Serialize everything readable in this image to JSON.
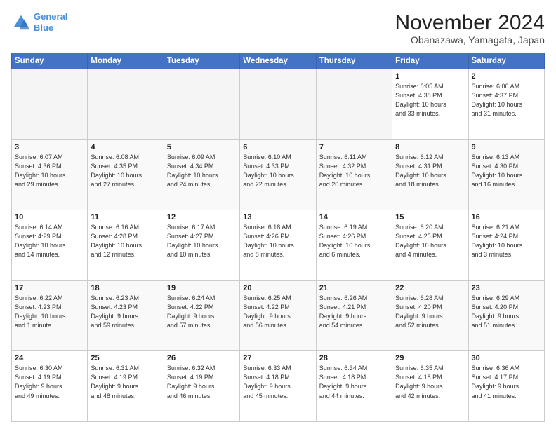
{
  "logo": {
    "line1": "General",
    "line2": "Blue"
  },
  "header": {
    "month": "November 2024",
    "location": "Obanazawa, Yamagata, Japan"
  },
  "weekdays": [
    "Sunday",
    "Monday",
    "Tuesday",
    "Wednesday",
    "Thursday",
    "Friday",
    "Saturday"
  ],
  "weeks": [
    [
      {
        "day": "",
        "info": ""
      },
      {
        "day": "",
        "info": ""
      },
      {
        "day": "",
        "info": ""
      },
      {
        "day": "",
        "info": ""
      },
      {
        "day": "",
        "info": ""
      },
      {
        "day": "1",
        "info": "Sunrise: 6:05 AM\nSunset: 4:38 PM\nDaylight: 10 hours\nand 33 minutes."
      },
      {
        "day": "2",
        "info": "Sunrise: 6:06 AM\nSunset: 4:37 PM\nDaylight: 10 hours\nand 31 minutes."
      }
    ],
    [
      {
        "day": "3",
        "info": "Sunrise: 6:07 AM\nSunset: 4:36 PM\nDaylight: 10 hours\nand 29 minutes."
      },
      {
        "day": "4",
        "info": "Sunrise: 6:08 AM\nSunset: 4:35 PM\nDaylight: 10 hours\nand 27 minutes."
      },
      {
        "day": "5",
        "info": "Sunrise: 6:09 AM\nSunset: 4:34 PM\nDaylight: 10 hours\nand 24 minutes."
      },
      {
        "day": "6",
        "info": "Sunrise: 6:10 AM\nSunset: 4:33 PM\nDaylight: 10 hours\nand 22 minutes."
      },
      {
        "day": "7",
        "info": "Sunrise: 6:11 AM\nSunset: 4:32 PM\nDaylight: 10 hours\nand 20 minutes."
      },
      {
        "day": "8",
        "info": "Sunrise: 6:12 AM\nSunset: 4:31 PM\nDaylight: 10 hours\nand 18 minutes."
      },
      {
        "day": "9",
        "info": "Sunrise: 6:13 AM\nSunset: 4:30 PM\nDaylight: 10 hours\nand 16 minutes."
      }
    ],
    [
      {
        "day": "10",
        "info": "Sunrise: 6:14 AM\nSunset: 4:29 PM\nDaylight: 10 hours\nand 14 minutes."
      },
      {
        "day": "11",
        "info": "Sunrise: 6:16 AM\nSunset: 4:28 PM\nDaylight: 10 hours\nand 12 minutes."
      },
      {
        "day": "12",
        "info": "Sunrise: 6:17 AM\nSunset: 4:27 PM\nDaylight: 10 hours\nand 10 minutes."
      },
      {
        "day": "13",
        "info": "Sunrise: 6:18 AM\nSunset: 4:26 PM\nDaylight: 10 hours\nand 8 minutes."
      },
      {
        "day": "14",
        "info": "Sunrise: 6:19 AM\nSunset: 4:26 PM\nDaylight: 10 hours\nand 6 minutes."
      },
      {
        "day": "15",
        "info": "Sunrise: 6:20 AM\nSunset: 4:25 PM\nDaylight: 10 hours\nand 4 minutes."
      },
      {
        "day": "16",
        "info": "Sunrise: 6:21 AM\nSunset: 4:24 PM\nDaylight: 10 hours\nand 3 minutes."
      }
    ],
    [
      {
        "day": "17",
        "info": "Sunrise: 6:22 AM\nSunset: 4:23 PM\nDaylight: 10 hours\nand 1 minute."
      },
      {
        "day": "18",
        "info": "Sunrise: 6:23 AM\nSunset: 4:23 PM\nDaylight: 9 hours\nand 59 minutes."
      },
      {
        "day": "19",
        "info": "Sunrise: 6:24 AM\nSunset: 4:22 PM\nDaylight: 9 hours\nand 57 minutes."
      },
      {
        "day": "20",
        "info": "Sunrise: 6:25 AM\nSunset: 4:22 PM\nDaylight: 9 hours\nand 56 minutes."
      },
      {
        "day": "21",
        "info": "Sunrise: 6:26 AM\nSunset: 4:21 PM\nDaylight: 9 hours\nand 54 minutes."
      },
      {
        "day": "22",
        "info": "Sunrise: 6:28 AM\nSunset: 4:20 PM\nDaylight: 9 hours\nand 52 minutes."
      },
      {
        "day": "23",
        "info": "Sunrise: 6:29 AM\nSunset: 4:20 PM\nDaylight: 9 hours\nand 51 minutes."
      }
    ],
    [
      {
        "day": "24",
        "info": "Sunrise: 6:30 AM\nSunset: 4:19 PM\nDaylight: 9 hours\nand 49 minutes."
      },
      {
        "day": "25",
        "info": "Sunrise: 6:31 AM\nSunset: 4:19 PM\nDaylight: 9 hours\nand 48 minutes."
      },
      {
        "day": "26",
        "info": "Sunrise: 6:32 AM\nSunset: 4:19 PM\nDaylight: 9 hours\nand 46 minutes."
      },
      {
        "day": "27",
        "info": "Sunrise: 6:33 AM\nSunset: 4:18 PM\nDaylight: 9 hours\nand 45 minutes."
      },
      {
        "day": "28",
        "info": "Sunrise: 6:34 AM\nSunset: 4:18 PM\nDaylight: 9 hours\nand 44 minutes."
      },
      {
        "day": "29",
        "info": "Sunrise: 6:35 AM\nSunset: 4:18 PM\nDaylight: 9 hours\nand 42 minutes."
      },
      {
        "day": "30",
        "info": "Sunrise: 6:36 AM\nSunset: 4:17 PM\nDaylight: 9 hours\nand 41 minutes."
      }
    ]
  ]
}
